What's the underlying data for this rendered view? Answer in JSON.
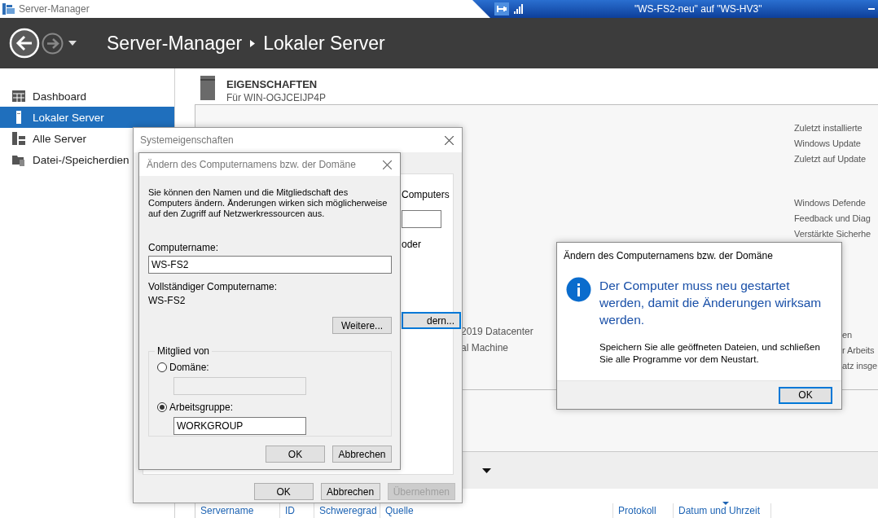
{
  "window": {
    "title": "Server-Manager"
  },
  "remote_bar": {
    "title": "\"WS-FS2-neu\" auf \"WS-HV3\""
  },
  "header": {
    "breadcrumb": [
      "Server-Manager",
      "Lokaler Server"
    ]
  },
  "sidebar": {
    "items": [
      {
        "label": "Dashboard",
        "kind": "dashboard",
        "selected": false
      },
      {
        "label": "Lokaler Server",
        "kind": "server",
        "selected": true
      },
      {
        "label": "Alle Server",
        "kind": "servers",
        "selected": false
      },
      {
        "label": "Datei-/Speicherdien",
        "kind": "files",
        "selected": false
      }
    ]
  },
  "properties": {
    "heading": "EIGENSCHAFTEN",
    "subtitle": "Für WIN-OGJCEIJP4P",
    "details": [
      "2019 Datacenter",
      "al Machine"
    ],
    "right_items": [
      "Zuletzt installierte",
      "Windows Update",
      "Zuletzt auf Update",
      "Windows Defende",
      "Feedback und Diag",
      "Verstärkte Sicherhe"
    ],
    "right_fragments": [
      "en",
      "r Arbeits",
      "atz insge"
    ]
  },
  "events": {
    "columns": [
      {
        "label": "Servername",
        "sorted": false
      },
      {
        "label": "ID",
        "sorted": false
      },
      {
        "label": "Schweregrad",
        "sorted": false
      },
      {
        "label": "Quelle",
        "sorted": false
      },
      {
        "label": "Protokoll",
        "sorted": false
      },
      {
        "label": "Datum und Uhrzeit",
        "sorted": true
      }
    ]
  },
  "system_properties": {
    "title": "Systemeigenschaften",
    "tab_fragments": {
      "text_1": "Computers",
      "text_2": "oder",
      "button": {
        "label": "dern...",
        "focused": true
      }
    },
    "buttons": [
      {
        "label": "OK",
        "disabled": false
      },
      {
        "label": "Abbrechen",
        "disabled": false
      },
      {
        "label": "Übernehmen",
        "disabled": true
      }
    ]
  },
  "rename_dialog": {
    "title": "Ändern des Computernamens bzw. der Domäne",
    "intro": "Sie können den Namen und die Mitgliedschaft des Computers ändern. Änderungen wirken sich möglicherweise auf den Zugriff auf Netzwerkressourcen aus.",
    "computer_name_label": "Computername:",
    "computer_name": "WS-FS2",
    "full_name_label": "Vollständiger Computername:",
    "full_name": "WS-FS2",
    "more_button": "Weitere...",
    "member_of": {
      "title": "Mitglied von",
      "options": [
        {
          "label": "Domäne:",
          "selected": false
        },
        {
          "label": "Arbeitsgruppe:",
          "selected": true,
          "value": "WORKGROUP"
        }
      ]
    },
    "buttons": [
      "OK",
      "Abbrechen"
    ]
  },
  "message_box": {
    "title": "Ändern des Computernamens bzw. der Domäne",
    "heading": "Der Computer muss neu gestartet werden, damit die Änderungen wirksam werden.",
    "body": "Speichern Sie alle geöffneten Dateien, und schließen Sie alle Programme vor dem Neustart.",
    "buttons": [
      {
        "label": "OK",
        "focused": true
      }
    ]
  }
}
